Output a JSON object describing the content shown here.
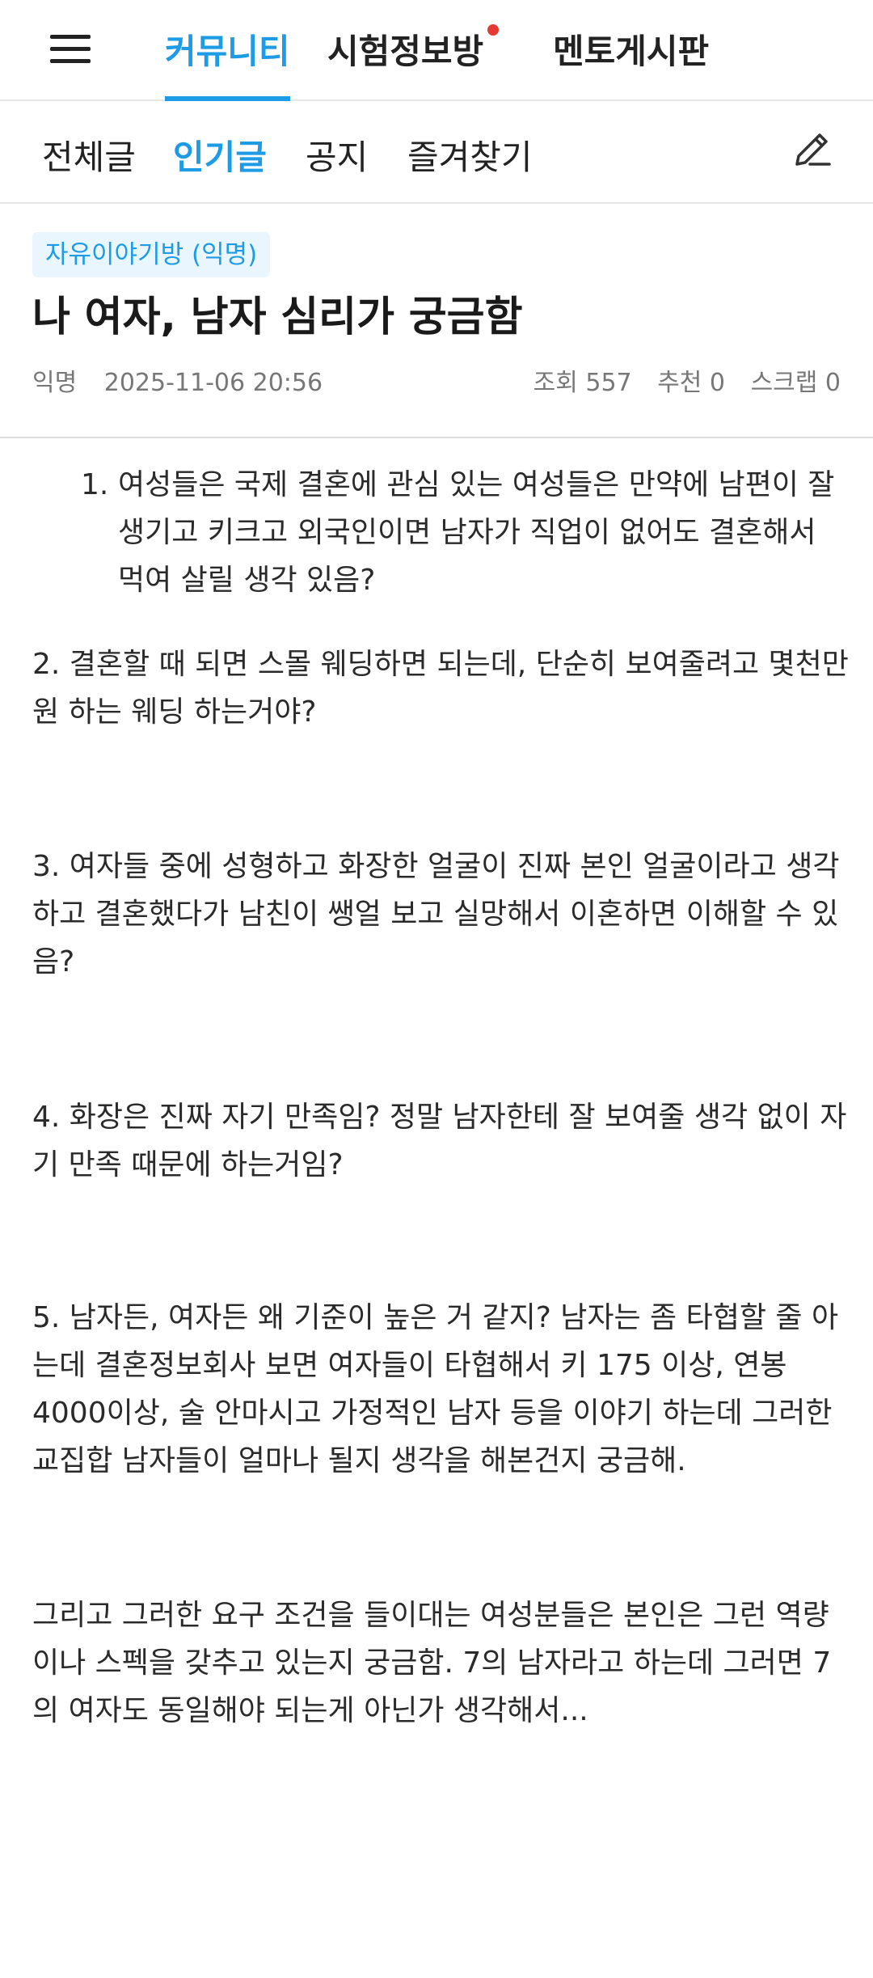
{
  "top_nav": {
    "tabs": [
      {
        "label": "커뮤니티",
        "active": true
      },
      {
        "label": "시험정보방",
        "active": false,
        "has_new_dot": true
      },
      {
        "label": "멘토게시판",
        "active": false
      }
    ]
  },
  "sub_nav": {
    "tabs": [
      {
        "label": "전체글",
        "active": false
      },
      {
        "label": "인기글",
        "active": true
      },
      {
        "label": "공지",
        "active": false
      },
      {
        "label": "즐겨찾기",
        "active": false
      }
    ]
  },
  "post": {
    "category": "자유이야기방 (익명)",
    "title": "나 여자, 남자 심리가 궁금함",
    "author": "익명",
    "date": "2025-11-06 20:56",
    "views": "조회 557",
    "recommends": "추천 0",
    "scraps": "스크랩 0",
    "list_item_1": {
      "number": "1.",
      "text": "여성들은 국제 결혼에 관심 있는 여성들은 만약에 남편이 잘생기고 키크고 외국인이면 남자가 직업이 없어도 결혼해서 먹여 살릴 생각 있음?"
    },
    "paragraphs": [
      "2. 결혼할 때 되면 스몰 웨딩하면 되는데, 단순히 보여줄려고 몇천만원 하는 웨딩 하는거야?",
      "3. 여자들 중에 성형하고 화장한 얼굴이 진짜 본인 얼굴이라고 생각하고 결혼했다가 남친이 쌩얼 보고 실망해서 이혼하면 이해할 수 있음?",
      "4. 화장은 진짜 자기 만족임? 정말 남자한테 잘 보여줄 생각 없이 자기 만족 때문에 하는거임?",
      "5. 남자든, 여자든 왜 기준이 높은 거 같지? 남자는 좀 타협할 줄 아는데 결혼정보회사 보면 여자들이 타협해서 키 175 이상, 연봉 4000이상, 술 안마시고 가정적인 남자 등을 이야기 하는데 그러한 교집합 남자들이 얼마나 될지 생각을 해본건지 궁금해.",
      "그리고 그러한 요구 조건을 들이대는 여성분들은 본인은 그런 역량이나 스펙을 갖추고 있는지 궁금함. 7의 남자라고 하는데 그러면 7의 여자도 동일해야 되는게 아닌가 생각해서..."
    ]
  },
  "colors": {
    "accent": "#1e9be5",
    "new_dot": "#e53935",
    "meta_text": "#777777"
  },
  "icons": {
    "menu": "hamburger-menu-icon",
    "edit": "pencil-icon"
  }
}
